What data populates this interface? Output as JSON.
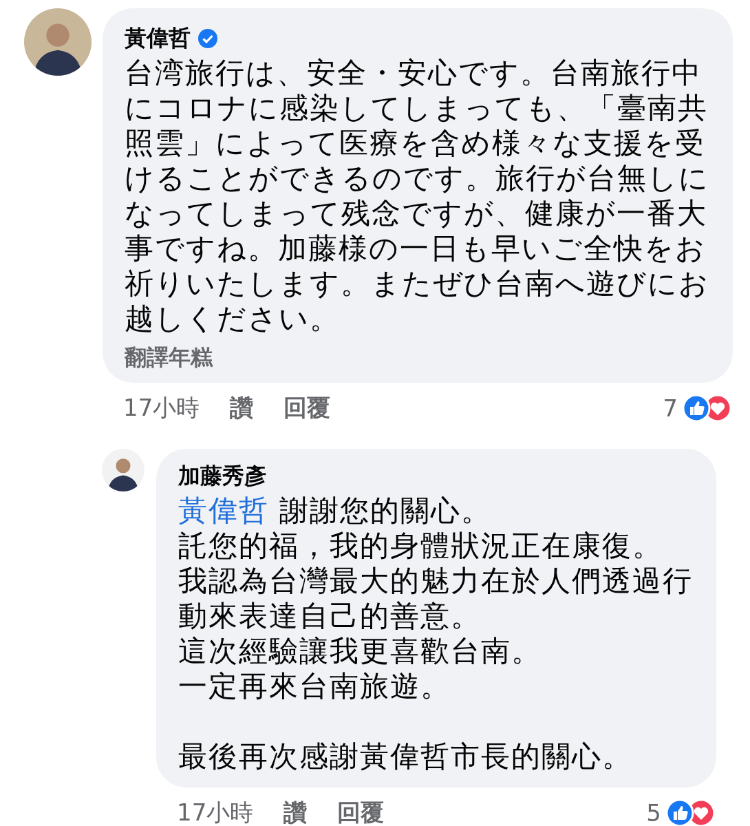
{
  "comments": [
    {
      "author": "黃偉哲",
      "verified": true,
      "body": "台湾旅行は、安全・安心です。台南旅行中にコロナに感染してしまっても、「臺南共照雲」によって医療を含め様々な支援を受けることができるのです。旅行が台無しになってしまって残念ですが、健康が一番大事ですね。加藤様の一日も早いご全快をお祈りいたします。またぜひ台南へ遊びにお越しください。",
      "translation": "翻譯年糕",
      "time": "17小時",
      "like": "讚",
      "reply": "回覆",
      "reaction_count": "7",
      "replies": [
        {
          "author": "加藤秀彥",
          "mention": "黃偉哲",
          "lines": [
            "謝謝您的關心。",
            "託您的福，我的身體狀況正在康復。",
            "我認為台灣最大的魅力在於人們透過行動來表達自己的善意。",
            "這次經驗讓我更喜歡台南。",
            "一定再來台南旅遊。"
          ],
          "closing": "最後再次感謝黃偉哲市長的關心。",
          "time": "17小時",
          "like": "讚",
          "reply": "回覆",
          "reaction_count": "5"
        }
      ]
    }
  ]
}
